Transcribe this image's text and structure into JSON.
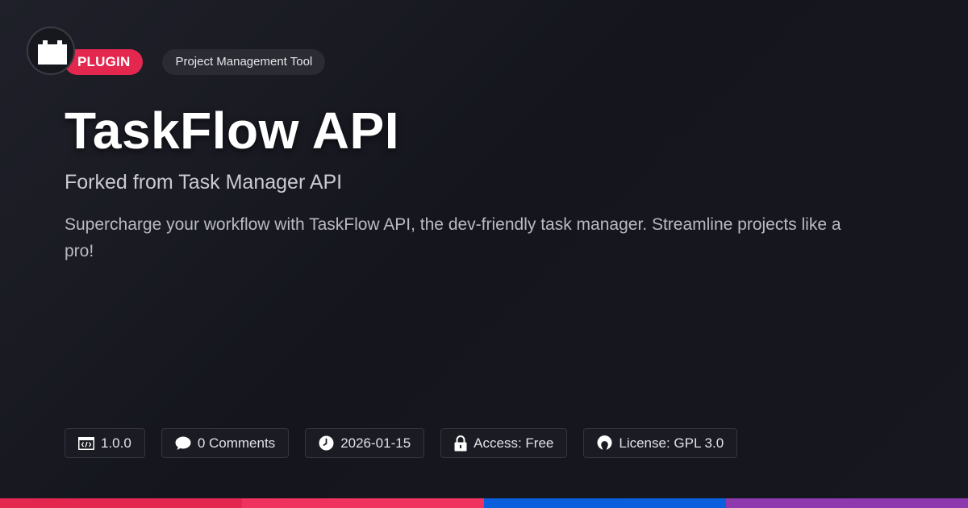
{
  "badges": {
    "type": "PLUGIN",
    "category": "Project Management Tool"
  },
  "title": "TaskFlow API",
  "subtitle": "Forked from Task Manager API",
  "description": "Supercharge your workflow with TaskFlow API, the dev-friendly task manager. Streamline projects like a pro!",
  "meta": {
    "version": "1.0.0",
    "comments": "0 Comments",
    "date": "2026-01-15",
    "access": "Access: Free",
    "license": "License: GPL 3.0"
  },
  "icons": {
    "logo": "plugin-block-icon",
    "version": "code-window-icon",
    "comments": "speech-bubble-icon",
    "date": "clock-icon",
    "access": "lock-icon",
    "license": "open-source-icon"
  },
  "colors": {
    "background": "#16171e",
    "plugin_badge": "#e3274f",
    "stripe": [
      "#e3274f",
      "#f0325f",
      "#0a5fdc",
      "#8e3aae"
    ]
  }
}
